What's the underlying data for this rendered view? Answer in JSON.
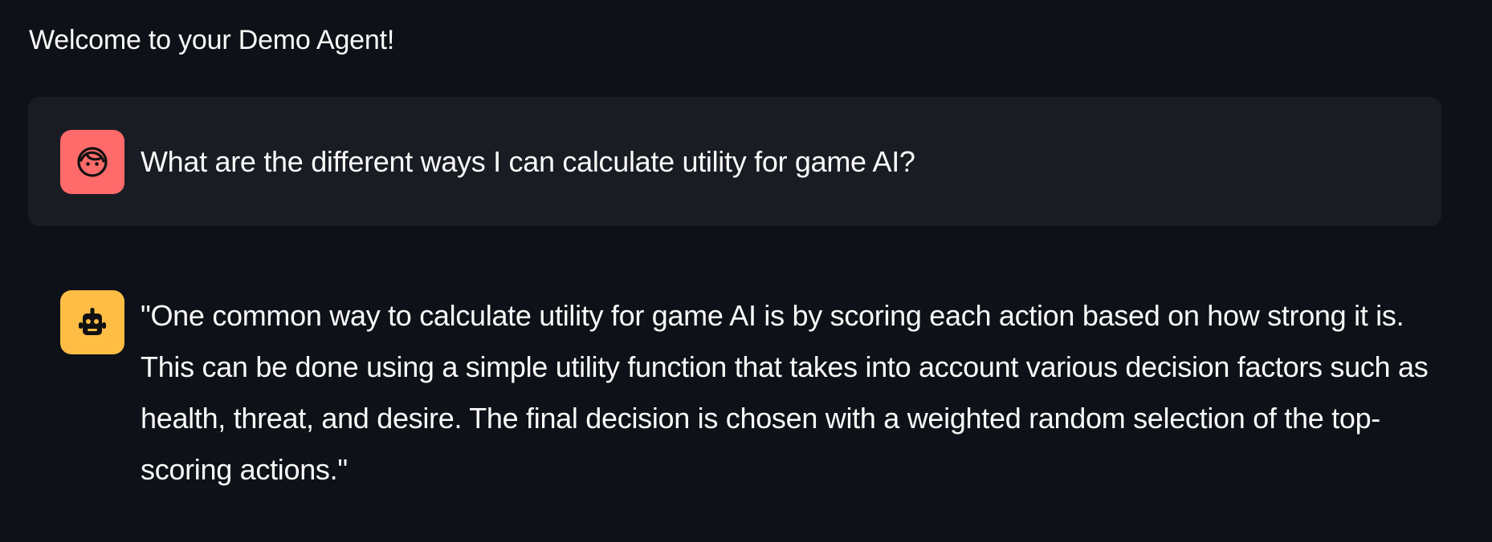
{
  "header": {
    "welcome_text": "Welcome to your Demo Agent!"
  },
  "messages": [
    {
      "role": "user",
      "avatar_icon": "user-face-icon",
      "avatar_color": "#ff6b6b",
      "text": "What are the different ways I can calculate utility for game AI?"
    },
    {
      "role": "assistant",
      "avatar_icon": "robot-icon",
      "avatar_color": "#ffbd45",
      "text": "\"One common way to calculate utility for game AI is by scoring each action based on how strong it is. This can be done using a simple utility function that takes into account various decision factors such as health, threat, and desire. The final decision is chosen with a weighted random selection of the top-scoring actions.\""
    }
  ],
  "theme": {
    "background": "#0e1117",
    "user_message_background": "#1a1c24",
    "text_color": "#fafafa"
  }
}
